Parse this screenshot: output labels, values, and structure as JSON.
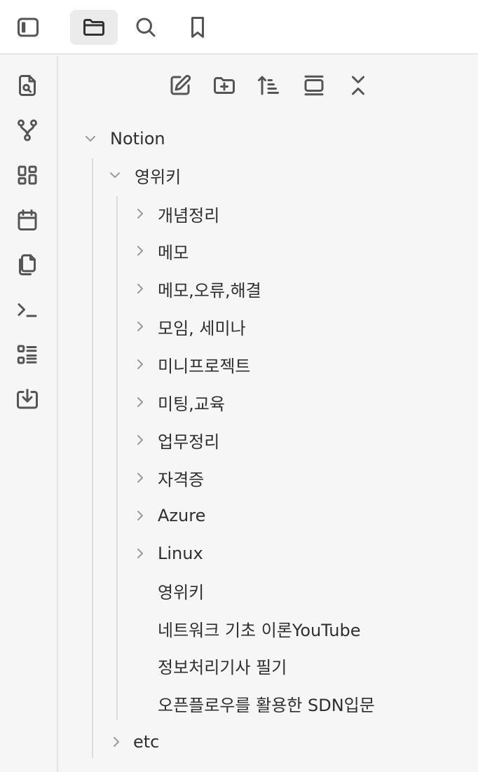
{
  "topbar": {
    "buttons": [
      {
        "name": "sidebar-toggle-icon",
        "active": false
      },
      {
        "name": "folder-icon",
        "active": true
      },
      {
        "name": "search-icon",
        "active": false
      },
      {
        "name": "bookmark-icon",
        "active": false
      }
    ]
  },
  "ribbon": {
    "icons": [
      "file-search-icon",
      "git-branch-icon",
      "dashboard-icon",
      "calendar-icon",
      "copy-icon",
      "terminal-icon",
      "list-icon",
      "download-icon"
    ]
  },
  "explorer": {
    "nav_icons": [
      "new-note-icon",
      "new-folder-icon",
      "sort-icon",
      "collapse-view-icon",
      "collapse-all-icon"
    ],
    "tree": {
      "root": {
        "label": "Notion",
        "expanded": true
      },
      "folder": {
        "label": "영위키",
        "expanded": true
      },
      "subfolders": [
        "개념정리",
        "메모",
        "메모,오류,해결",
        "모임, 세미나",
        "미니프로젝트",
        "미팅,교육",
        "업무정리",
        "자격증",
        "Azure",
        "Linux"
      ],
      "files": [
        "영위키",
        "네트워크 기초 이론YouTube",
        "정보처리기사 필기",
        "오픈플로우를 활용한 SDN입문"
      ],
      "sibling": {
        "label": "etc",
        "expanded": false
      }
    }
  },
  "colors": {
    "background": "#f6f6f6",
    "topbar": "#ffffff",
    "active_tab": "#ebebeb",
    "icon": "#555555",
    "chevron": "#9a9a9a",
    "guide": "#dcdcdc"
  }
}
